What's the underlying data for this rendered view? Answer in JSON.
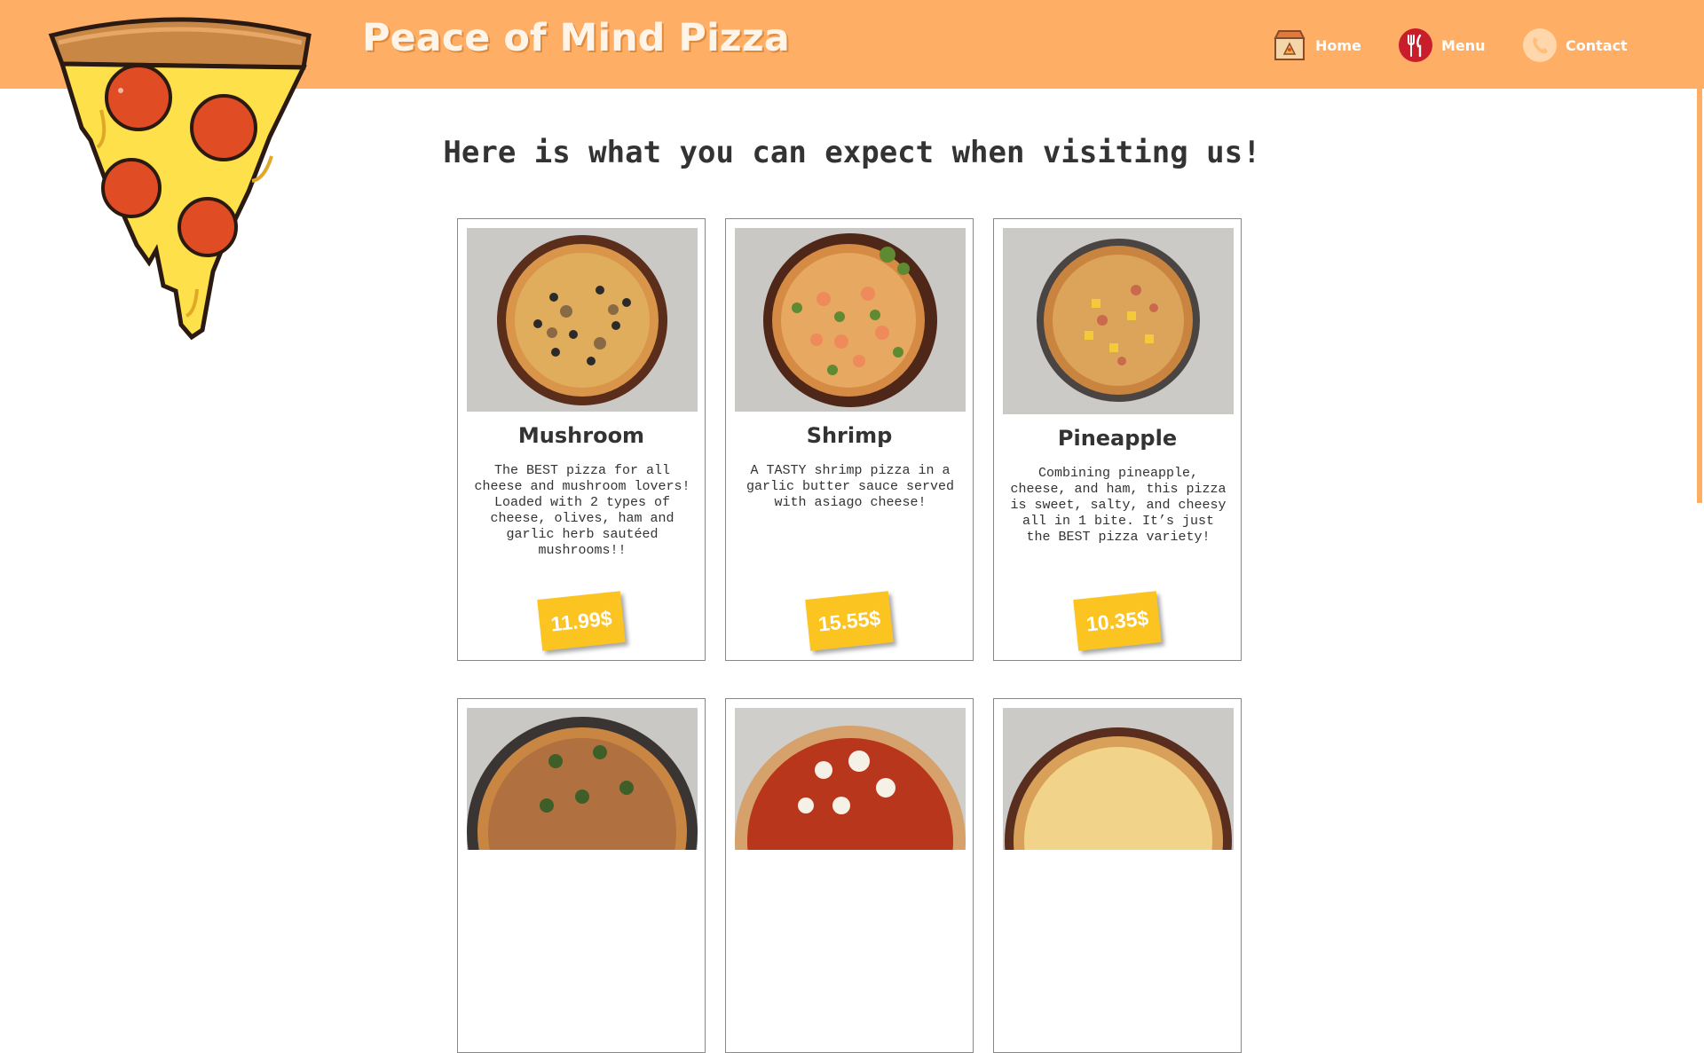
{
  "header": {
    "brand": "Peace of Mind Pizza",
    "nav": [
      {
        "label": "Home",
        "icon": "pizza-box-icon"
      },
      {
        "label": "Menu",
        "icon": "fork-knife-icon"
      },
      {
        "label": "Contact",
        "icon": "phone-icon"
      }
    ]
  },
  "main": {
    "heading": "Here is what you can expect when visiting us!",
    "cards": [
      {
        "title": "Mushroom",
        "description": "The BEST pizza for all cheese and mushroom lovers! Loaded with 2 types of cheese, olives, ham and garlic herb sautéed mushrooms!!",
        "price": "11.99$",
        "image": "mushroom-pizza-photo"
      },
      {
        "title": "Shrimp",
        "description": "A TASTY shrimp pizza in a garlic butter sauce served with asiago cheese!",
        "price": "15.55$",
        "image": "shrimp-pizza-photo"
      },
      {
        "title": "Pineapple",
        "description": "Combining pineapple, cheese, and ham, this pizza is sweet, salty, and cheesy all in 1 bite. It’s just the BEST pizza variety!",
        "price": "10.35$",
        "image": "pineapple-pizza-photo"
      }
    ],
    "more_cards": [
      {
        "image": "spinach-sausage-pizza-photo"
      },
      {
        "image": "margherita-pizza-photo"
      },
      {
        "image": "cheese-pizza-photo"
      }
    ]
  },
  "colors": {
    "header": "#ffae65",
    "price_tag": "#fbc420",
    "text": "#333333"
  }
}
